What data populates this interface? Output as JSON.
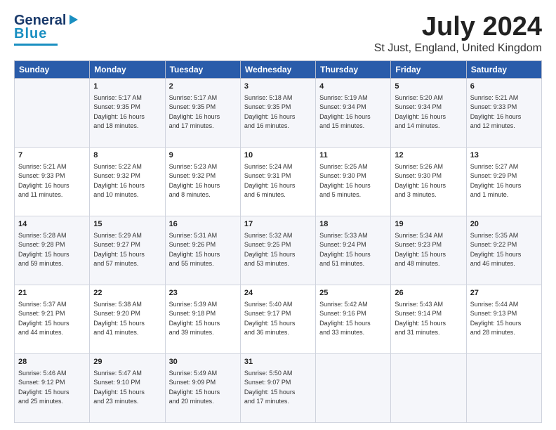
{
  "header": {
    "logo_line1": "General",
    "logo_line2": "Blue",
    "title": "July 2024",
    "subtitle": "St Just, England, United Kingdom"
  },
  "days_of_week": [
    "Sunday",
    "Monday",
    "Tuesday",
    "Wednesday",
    "Thursday",
    "Friday",
    "Saturday"
  ],
  "weeks": [
    [
      {
        "day": "",
        "content": ""
      },
      {
        "day": "1",
        "content": "Sunrise: 5:17 AM\nSunset: 9:35 PM\nDaylight: 16 hours\nand 18 minutes."
      },
      {
        "day": "2",
        "content": "Sunrise: 5:17 AM\nSunset: 9:35 PM\nDaylight: 16 hours\nand 17 minutes."
      },
      {
        "day": "3",
        "content": "Sunrise: 5:18 AM\nSunset: 9:35 PM\nDaylight: 16 hours\nand 16 minutes."
      },
      {
        "day": "4",
        "content": "Sunrise: 5:19 AM\nSunset: 9:34 PM\nDaylight: 16 hours\nand 15 minutes."
      },
      {
        "day": "5",
        "content": "Sunrise: 5:20 AM\nSunset: 9:34 PM\nDaylight: 16 hours\nand 14 minutes."
      },
      {
        "day": "6",
        "content": "Sunrise: 5:21 AM\nSunset: 9:33 PM\nDaylight: 16 hours\nand 12 minutes."
      }
    ],
    [
      {
        "day": "7",
        "content": "Sunrise: 5:21 AM\nSunset: 9:33 PM\nDaylight: 16 hours\nand 11 minutes."
      },
      {
        "day": "8",
        "content": "Sunrise: 5:22 AM\nSunset: 9:32 PM\nDaylight: 16 hours\nand 10 minutes."
      },
      {
        "day": "9",
        "content": "Sunrise: 5:23 AM\nSunset: 9:32 PM\nDaylight: 16 hours\nand 8 minutes."
      },
      {
        "day": "10",
        "content": "Sunrise: 5:24 AM\nSunset: 9:31 PM\nDaylight: 16 hours\nand 6 minutes."
      },
      {
        "day": "11",
        "content": "Sunrise: 5:25 AM\nSunset: 9:30 PM\nDaylight: 16 hours\nand 5 minutes."
      },
      {
        "day": "12",
        "content": "Sunrise: 5:26 AM\nSunset: 9:30 PM\nDaylight: 16 hours\nand 3 minutes."
      },
      {
        "day": "13",
        "content": "Sunrise: 5:27 AM\nSunset: 9:29 PM\nDaylight: 16 hours\nand 1 minute."
      }
    ],
    [
      {
        "day": "14",
        "content": "Sunrise: 5:28 AM\nSunset: 9:28 PM\nDaylight: 15 hours\nand 59 minutes."
      },
      {
        "day": "15",
        "content": "Sunrise: 5:29 AM\nSunset: 9:27 PM\nDaylight: 15 hours\nand 57 minutes."
      },
      {
        "day": "16",
        "content": "Sunrise: 5:31 AM\nSunset: 9:26 PM\nDaylight: 15 hours\nand 55 minutes."
      },
      {
        "day": "17",
        "content": "Sunrise: 5:32 AM\nSunset: 9:25 PM\nDaylight: 15 hours\nand 53 minutes."
      },
      {
        "day": "18",
        "content": "Sunrise: 5:33 AM\nSunset: 9:24 PM\nDaylight: 15 hours\nand 51 minutes."
      },
      {
        "day": "19",
        "content": "Sunrise: 5:34 AM\nSunset: 9:23 PM\nDaylight: 15 hours\nand 48 minutes."
      },
      {
        "day": "20",
        "content": "Sunrise: 5:35 AM\nSunset: 9:22 PM\nDaylight: 15 hours\nand 46 minutes."
      }
    ],
    [
      {
        "day": "21",
        "content": "Sunrise: 5:37 AM\nSunset: 9:21 PM\nDaylight: 15 hours\nand 44 minutes."
      },
      {
        "day": "22",
        "content": "Sunrise: 5:38 AM\nSunset: 9:20 PM\nDaylight: 15 hours\nand 41 minutes."
      },
      {
        "day": "23",
        "content": "Sunrise: 5:39 AM\nSunset: 9:18 PM\nDaylight: 15 hours\nand 39 minutes."
      },
      {
        "day": "24",
        "content": "Sunrise: 5:40 AM\nSunset: 9:17 PM\nDaylight: 15 hours\nand 36 minutes."
      },
      {
        "day": "25",
        "content": "Sunrise: 5:42 AM\nSunset: 9:16 PM\nDaylight: 15 hours\nand 33 minutes."
      },
      {
        "day": "26",
        "content": "Sunrise: 5:43 AM\nSunset: 9:14 PM\nDaylight: 15 hours\nand 31 minutes."
      },
      {
        "day": "27",
        "content": "Sunrise: 5:44 AM\nSunset: 9:13 PM\nDaylight: 15 hours\nand 28 minutes."
      }
    ],
    [
      {
        "day": "28",
        "content": "Sunrise: 5:46 AM\nSunset: 9:12 PM\nDaylight: 15 hours\nand 25 minutes."
      },
      {
        "day": "29",
        "content": "Sunrise: 5:47 AM\nSunset: 9:10 PM\nDaylight: 15 hours\nand 23 minutes."
      },
      {
        "day": "30",
        "content": "Sunrise: 5:49 AM\nSunset: 9:09 PM\nDaylight: 15 hours\nand 20 minutes."
      },
      {
        "day": "31",
        "content": "Sunrise: 5:50 AM\nSunset: 9:07 PM\nDaylight: 15 hours\nand 17 minutes."
      },
      {
        "day": "",
        "content": ""
      },
      {
        "day": "",
        "content": ""
      },
      {
        "day": "",
        "content": ""
      }
    ]
  ]
}
